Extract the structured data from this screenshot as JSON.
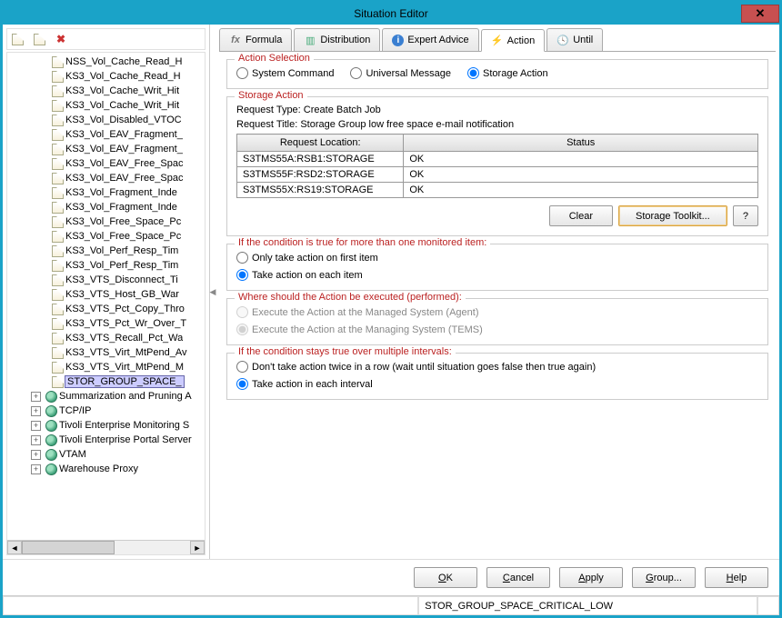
{
  "window": {
    "title": "Situation Editor"
  },
  "toolbar": {
    "new_doc": "new-situation",
    "copy_doc": "copy-situation",
    "delete": "delete-situation"
  },
  "tree": {
    "items": [
      "NSS_Vol_Cache_Read_H",
      "KS3_Vol_Cache_Read_H",
      "KS3_Vol_Cache_Writ_Hit",
      "KS3_Vol_Cache_Writ_Hit",
      "KS3_Vol_Disabled_VTOC",
      "KS3_Vol_EAV_Fragment_",
      "KS3_Vol_EAV_Fragment_",
      "KS3_Vol_EAV_Free_Spac",
      "KS3_Vol_EAV_Free_Spac",
      "KS3_Vol_Fragment_Inde",
      "KS3_Vol_Fragment_Inde",
      "KS3_Vol_Free_Space_Pc",
      "KS3_Vol_Free_Space_Pc",
      "KS3_Vol_Perf_Resp_Tim",
      "KS3_Vol_Perf_Resp_Tim",
      "KS3_VTS_Disconnect_Ti",
      "KS3_VTS_Host_GB_War",
      "KS3_VTS_Pct_Copy_Thro",
      "KS3_VTS_Pct_Wr_Over_T",
      "KS3_VTS_Recall_Pct_Wa",
      "KS3_VTS_Virt_MtPend_Av",
      "KS3_VTS_Virt_MtPend_M"
    ],
    "selected": "STOR_GROUP_SPACE_",
    "top_nodes": [
      "Summarization and Pruning A",
      "TCP/IP",
      "Tivoli Enterprise Monitoring S",
      "Tivoli Enterprise Portal Server",
      "VTAM",
      "Warehouse Proxy"
    ]
  },
  "tabs": {
    "formula": "Formula",
    "distribution": "Distribution",
    "expert": "Expert Advice",
    "action": "Action",
    "until": "Until"
  },
  "action_selection": {
    "legend": "Action Selection",
    "system_command": "System Command",
    "universal_message": "Universal Message",
    "storage_action": "Storage Action"
  },
  "storage_action": {
    "legend": "Storage Action",
    "request_type_label": "Request Type:",
    "request_type_value": "Create Batch Job",
    "request_title_label": "Request Title:",
    "request_title_value": "Storage Group low free space e-mail notification",
    "col_location": "Request Location:",
    "col_status": "Status",
    "rows": [
      {
        "loc": "S3TMS55A:RSB1:STORAGE",
        "status": "OK"
      },
      {
        "loc": "S3TMS55F:RSD2:STORAGE",
        "status": "OK"
      },
      {
        "loc": "S3TMS55X:RS19:STORAGE",
        "status": "OK"
      }
    ],
    "clear": "Clear",
    "toolkit": "Storage Toolkit...",
    "help_q": "?"
  },
  "multi_item": {
    "legend": "If the condition is true for more than one monitored item:",
    "first": "Only take action on first item",
    "each": "Take action on each item"
  },
  "where_exec": {
    "legend": "Where should the Action be executed (performed):",
    "agent": "Execute the Action at the Managed System (Agent)",
    "tems": "Execute the Action at the Managing System (TEMS)"
  },
  "stays_true": {
    "legend": "If the condition stays true over multiple intervals:",
    "once": "Don't take action twice in a row (wait until situation goes false then true again)",
    "each": "Take action in each interval"
  },
  "footer": {
    "ok": "OK",
    "cancel": "Cancel",
    "apply": "Apply",
    "group": "Group...",
    "help": "Help"
  },
  "status": {
    "situation": "STOR_GROUP_SPACE_CRITICAL_LOW"
  }
}
